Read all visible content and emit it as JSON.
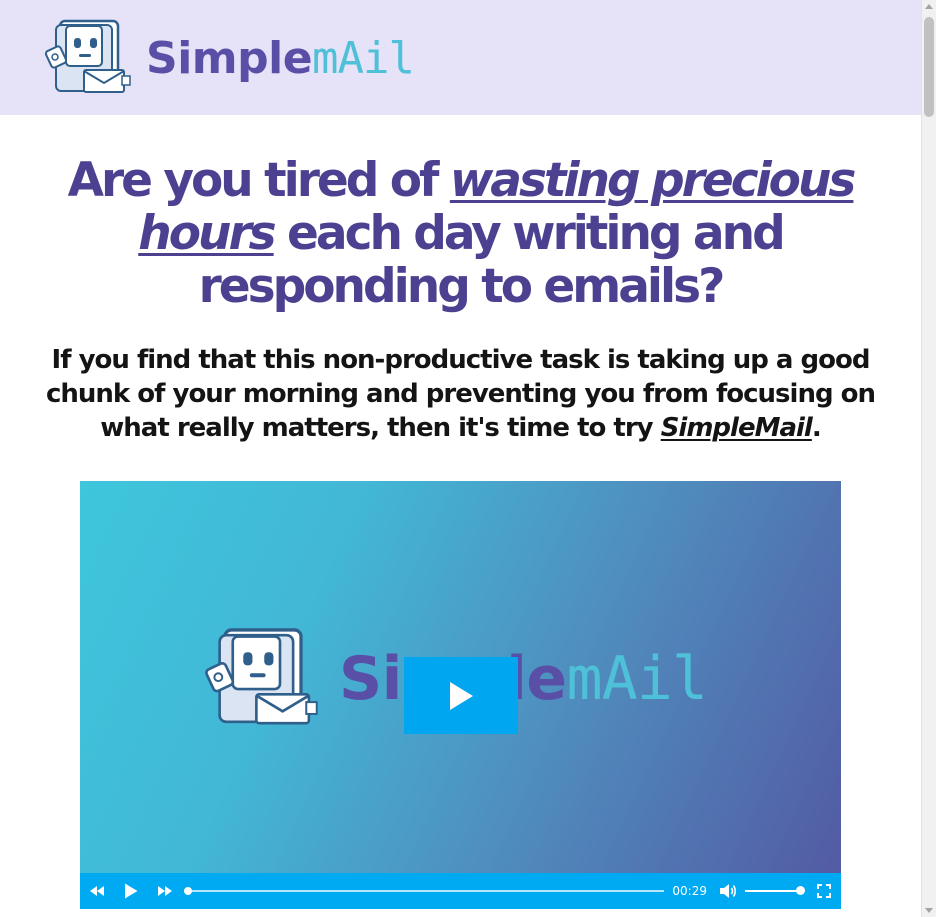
{
  "colors": {
    "header_bg": "#e6e2f8",
    "headline": "#4b4190",
    "brand_purple": "#5a4fa6",
    "brand_cyan": "#4ec0d8",
    "player_blue": "#00aaf2"
  },
  "header": {
    "logo_text_primary": "Simple",
    "logo_text_secondary": "mAil",
    "logo_icon": "robot-mail-icon"
  },
  "headline": {
    "part1": "Are you tired of ",
    "emphasis": "wasting precious hours",
    "part2": " each day writing and responding to emails?"
  },
  "subheadline": {
    "text": "If you find that this non-productive task is taking up a good chunk of your morning and preventing you from focusing on what really matters, then it's time to try ",
    "brand": "SimpleMail",
    "end": "."
  },
  "video": {
    "poster_text_primary": "Simple",
    "poster_text_secondary": "mAil",
    "time": "00:29",
    "progress": 0,
    "volume": 1.0,
    "icons": [
      "rewind-icon",
      "play-icon",
      "fast-forward-icon",
      "volume-icon",
      "fullscreen-icon"
    ]
  }
}
